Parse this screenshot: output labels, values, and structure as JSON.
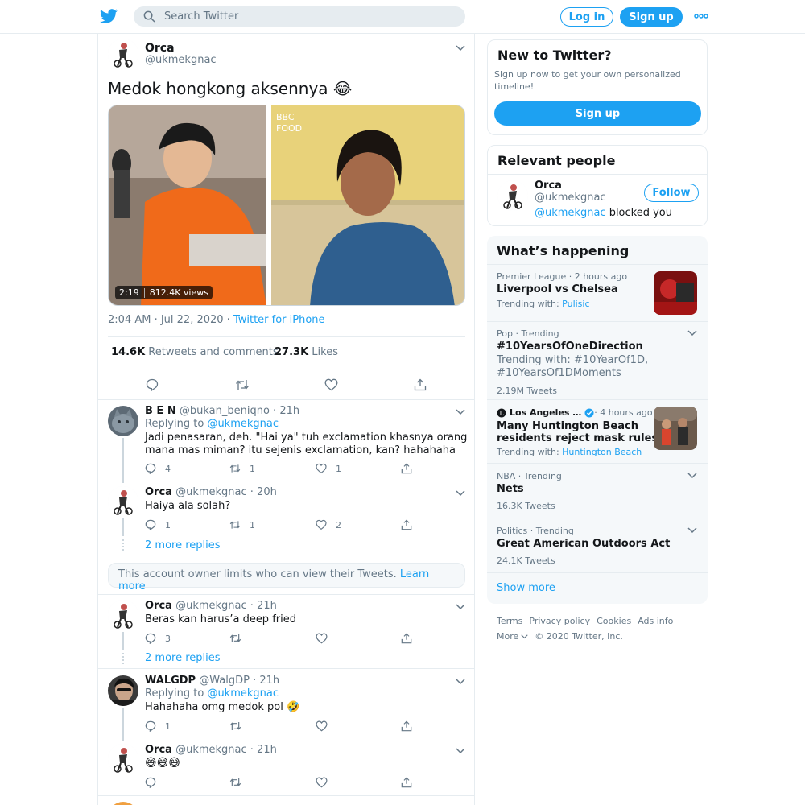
{
  "header": {
    "search_placeholder": "Search Twitter",
    "login_label": "Log in",
    "signup_label": "Sign up"
  },
  "tweet": {
    "author_name": "Orca",
    "author_handle": "@ukmekgnac",
    "text": "Medok hongkong aksennya 😂",
    "video_duration": "2:19",
    "video_views": "812.4K views",
    "video_overlay": "BBC FOOD",
    "time": "2:04 AM · Jul 22, 2020 · ",
    "source": "Twitter for iPhone",
    "retweets_count": "14.6K",
    "retweets_label": "Retweets and comments",
    "likes_count": "27.3K",
    "likes_label": "Likes"
  },
  "replies": [
    {
      "name": "B E N",
      "meta": "@bukan_beniqno · 21h",
      "replying_label": "Replying to",
      "replying_to": "@ukmekgnac",
      "text1": "Jadi penasaran, deh. \"Hai ya\" tuh exclamation khasnya orang",
      "text2": "mana mas miman? itu sejenis exclamation, kan? hahahaha",
      "reply_count": "4",
      "retweet_count": "1",
      "like_count": "1"
    },
    {
      "name": "Orca",
      "meta": "@ukmekgnac · 20h",
      "text": "Haiya ala solah?",
      "reply_count": "1",
      "retweet_count": "1",
      "like_count": "2"
    },
    {
      "name": "Orca",
      "meta": "@ukmekgnac · 21h",
      "text": "Beras kan harus’a deep fried",
      "reply_count": "3"
    },
    {
      "name": "WALGDP",
      "meta": "@WalgDP · 21h",
      "replying_label": "Replying to",
      "replying_to": "@ukmekgnac",
      "text": "Hahahaha omg medok pol 🤣",
      "reply_count": "1"
    },
    {
      "name": "Orca",
      "meta": "@ukmekgnac · 21h",
      "text": "😅😅😅"
    }
  ],
  "more_replies_label": "2 more replies",
  "limits": {
    "text": "This account owner limits who can view their Tweets.",
    "link": "Learn more"
  },
  "sidebar": {
    "new_title": "New to Twitter?",
    "new_desc_1": "Sign up now to get your own personalized",
    "new_desc_2": "timeline!",
    "signup_label": "Sign up",
    "relevant_title": "Relevant people",
    "person_name": "Orca",
    "person_handle": "@ukmekgnac",
    "person_status_handle": "@ukmekgnac",
    "person_status_text": " blocked you",
    "follow_label": "Follow",
    "happening_title": "What’s happening",
    "trends": [
      {
        "meta": "Premier League · 2 hours ago",
        "title": "Liverpool vs Chelsea",
        "with_label": "Trending with:",
        "with_link": "Pulisic"
      },
      {
        "meta": "Pop · Trending",
        "title": "#10YearsOfOneDirection",
        "line2": "Trending with: #10YearOf1D,",
        "line3": "#10YearsOf1DMoments",
        "count": "2.19M Tweets"
      },
      {
        "source": "Los Angeles …",
        "meta": " · 4 hours ago",
        "title1": "Many Huntington Beach",
        "title2": "residents reject mask rules",
        "with_label": "Trending with:",
        "with_link": "Huntington Beach"
      },
      {
        "meta": "NBA · Trending",
        "title": "Nets",
        "count": "16.3K Tweets"
      },
      {
        "meta": "Politics · Trending",
        "title": "Great American Outdoors Act",
        "count": "24.1K Tweets"
      }
    ],
    "show_more": "Show more"
  },
  "footer": {
    "links": [
      "Terms",
      "Privacy policy",
      "Cookies",
      "Ads info"
    ],
    "more": "More",
    "copyright": "© 2020 Twitter, Inc."
  },
  "colors": {
    "accent": "#1da1f2",
    "text": "#14171a",
    "secondary": "#657786",
    "border": "#e6ecf0"
  }
}
